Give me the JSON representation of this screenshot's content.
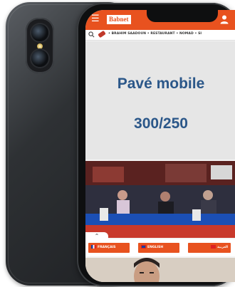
{
  "header": {
    "logo_text": "Babnet",
    "menu_icon": "hamburger-icon",
    "user_icon": "user-icon",
    "accent_color": "#e8521f"
  },
  "ticker": {
    "text": "• BRAHIM SAADOUN • RESTAURANT • NOMAD • SI"
  },
  "ad": {
    "title": "Pavé mobile",
    "size": "300/250",
    "text_color": "#2b5789"
  },
  "languages": [
    {
      "label": "FRANÇAIS"
    },
    {
      "label": "ENGLISH"
    },
    {
      "label": "العربية"
    }
  ]
}
